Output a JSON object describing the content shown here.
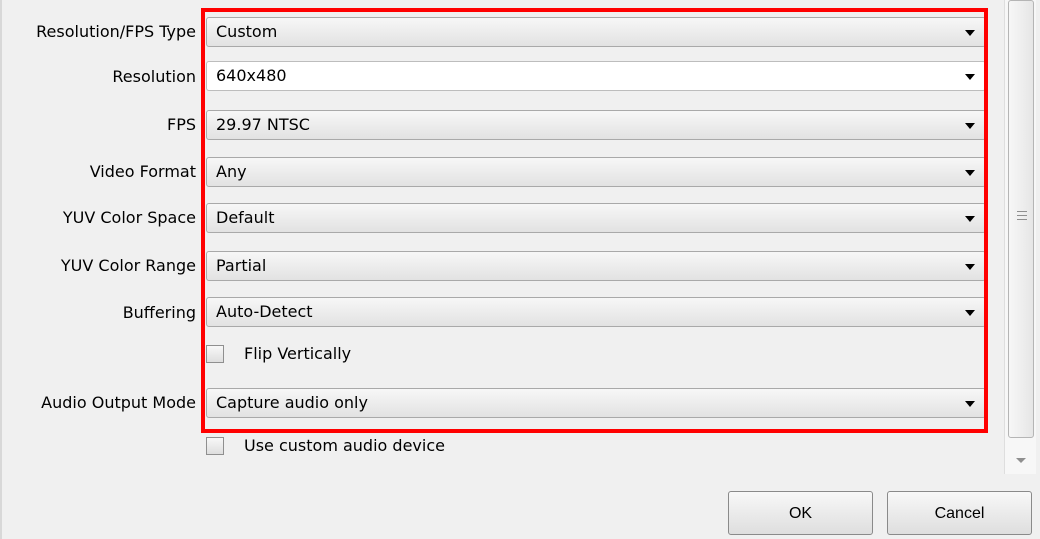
{
  "form": {
    "rows": [
      {
        "label": "Resolution/FPS Type",
        "value": "Custom"
      },
      {
        "label": "Resolution",
        "value": "640x480"
      },
      {
        "label": "FPS",
        "value": "29.97 NTSC"
      },
      {
        "label": "Video Format",
        "value": "Any"
      },
      {
        "label": "YUV Color Space",
        "value": "Default"
      },
      {
        "label": "YUV Color Range",
        "value": "Partial"
      },
      {
        "label": "Buffering",
        "value": "Auto-Detect"
      },
      {
        "label": "Audio Output Mode",
        "value": "Capture audio only"
      }
    ],
    "checkboxes": [
      {
        "label": "Flip Vertically",
        "checked": false
      },
      {
        "label": "Use custom audio device",
        "checked": false
      }
    ]
  },
  "buttons": {
    "ok": "OK",
    "cancel": "Cancel"
  },
  "icons": {
    "dropdown": "chevron-down-icon",
    "scroll_grip": "scroll-grip-icon",
    "scroll_down": "scroll-down-icon"
  },
  "colors": {
    "highlight": "#ff0000",
    "background": "#f0f0f0"
  }
}
